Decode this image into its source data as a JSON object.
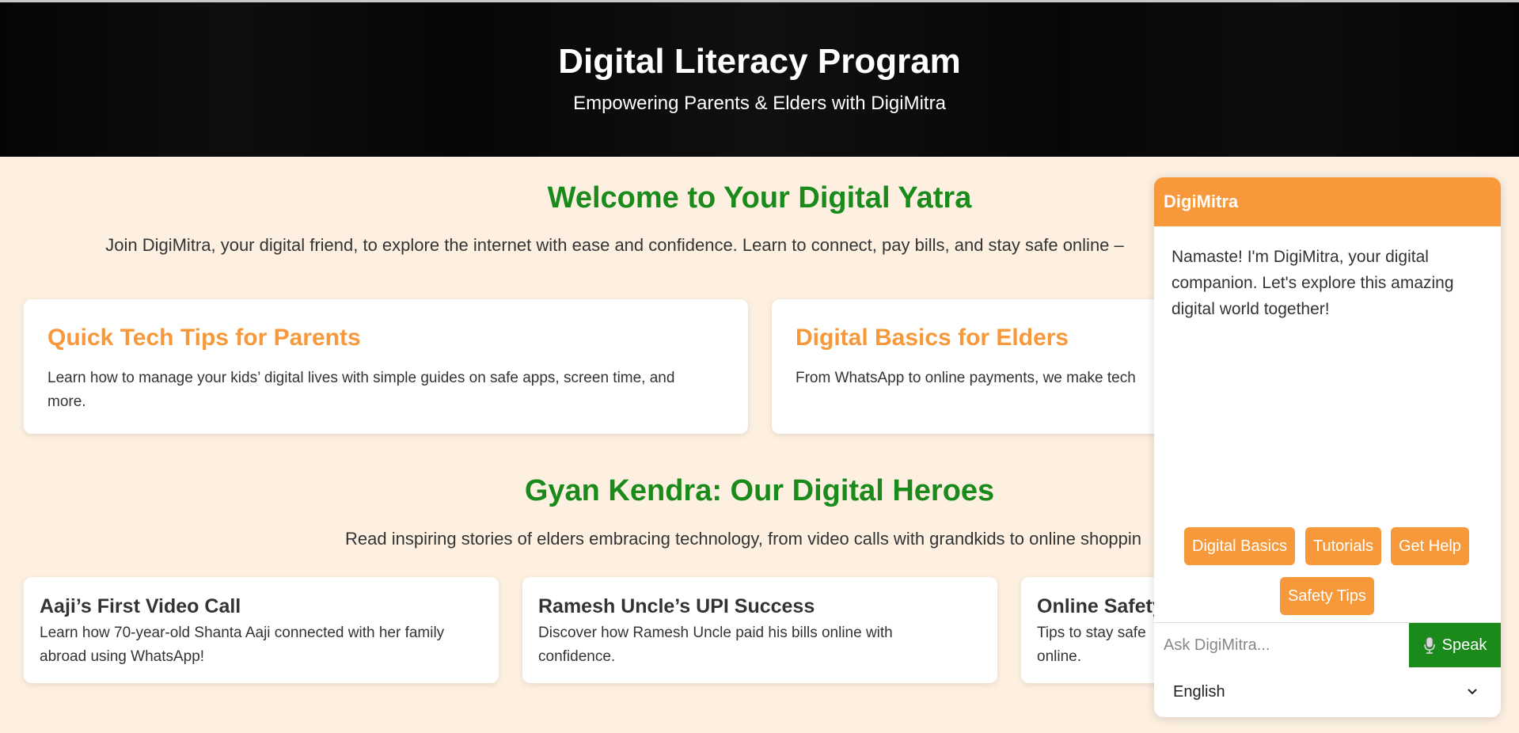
{
  "hero": {
    "title": "Digital Literacy Program",
    "subtitle": "Empowering Parents & Elders with DigiMitra"
  },
  "welcome": {
    "title": "Welcome to Your Digital Yatra",
    "description": "Join DigiMitra, your digital friend, to explore the internet with ease and confidence. Learn to connect, pay bills, and stay safe online –"
  },
  "feature_cards": [
    {
      "title": "Quick Tech Tips for Parents",
      "text": "Learn how to manage your kids’ digital lives with simple guides on safe apps, screen time, and more."
    },
    {
      "title": "Digital Basics for Elders",
      "text": "From WhatsApp to online payments, we make tech"
    }
  ],
  "heroes": {
    "title": "Gyan Kendra: Our Digital Heroes",
    "description": "Read inspiring stories of elders embracing technology, from video calls with grandkids to online shoppin",
    "stories": [
      {
        "title": "Aaji’s First Video Call",
        "text": "Learn how 70-year-old Shanta Aaji connected with her family abroad using WhatsApp!"
      },
      {
        "title": "Ramesh Uncle’s UPI Success",
        "text": "Discover how Ramesh Uncle paid his bills online with confidence."
      },
      {
        "title": "Online Safety",
        "text": "Tips to stay safe online."
      }
    ]
  },
  "chat": {
    "header": "DigiMitra",
    "message": "Namaste! I'm DigiMitra, your digital companion. Let's explore this amazing digital world together!",
    "quick_replies": [
      "Digital Basics",
      "Tutorials",
      "Get Help",
      "Safety Tips"
    ],
    "input_placeholder": "Ask DigiMitra...",
    "speak_label": "Speak",
    "language": "English"
  },
  "colors": {
    "accent_orange": "#f7993a",
    "heading_green": "#1a8a1a",
    "page_bg": "#fdf0e1"
  }
}
